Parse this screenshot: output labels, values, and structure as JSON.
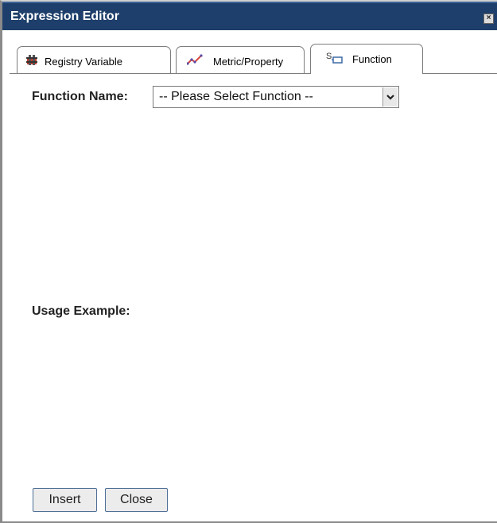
{
  "window": {
    "title": "Expression Editor"
  },
  "tabs": [
    {
      "label": "Registry Variable",
      "icon": "registry-icon",
      "active": false
    },
    {
      "label": "Metric/Property",
      "icon": "metric-icon",
      "active": false
    },
    {
      "label": "Function",
      "icon": "function-icon",
      "active": true
    }
  ],
  "function_select": {
    "label": "Function Name:",
    "selected": "-- Please Select Function --"
  },
  "usage": {
    "label": "Usage Example:"
  },
  "buttons": {
    "insert": "Insert",
    "close": "Close"
  },
  "colors": {
    "titlebar": "#1e3f6b",
    "title_text": "#ffffff",
    "border": "#7d7d7d"
  }
}
